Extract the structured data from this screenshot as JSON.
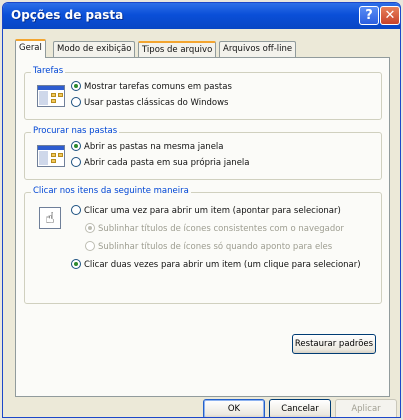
{
  "window": {
    "title": "Opções de pasta",
    "help_label": "?",
    "close_label": "✕"
  },
  "tabs": [
    {
      "label": "Geral",
      "active": true
    },
    {
      "label": "Modo de exibição",
      "active": false
    },
    {
      "label": "Tipos de arquivo",
      "active": false
    },
    {
      "label": "Arquivos off-line",
      "active": false
    }
  ],
  "groups": {
    "tarefas": {
      "label": "Tarefas",
      "options": [
        {
          "label": "Mostrar tarefas comuns em pastas",
          "checked": true
        },
        {
          "label": "Usar pastas clássicas do Windows",
          "checked": false
        }
      ]
    },
    "procurar": {
      "label": "Procurar nas pastas",
      "options": [
        {
          "label": "Abrir as pastas na mesma janela",
          "checked": true
        },
        {
          "label": "Abrir cada pasta em sua própria janela",
          "checked": false
        }
      ]
    },
    "clicar": {
      "label": "Clicar nos itens da seguinte maneira",
      "options": [
        {
          "label": "Clicar uma vez para abrir um item (apontar para selecionar)",
          "checked": false
        },
        {
          "label": "Sublinhar títulos de ícones consistentes com o navegador",
          "checked": true,
          "disabled": true
        },
        {
          "label": "Sublinhar títulos de ícones só quando aponto para eles",
          "checked": false,
          "disabled": true
        },
        {
          "label": "Clicar duas vezes para abrir um item (um clique para selecionar)",
          "checked": true
        }
      ]
    }
  },
  "buttons": {
    "restore": "Restaurar padrões",
    "ok": "OK",
    "cancel": "Cancelar",
    "apply": "Aplicar"
  }
}
